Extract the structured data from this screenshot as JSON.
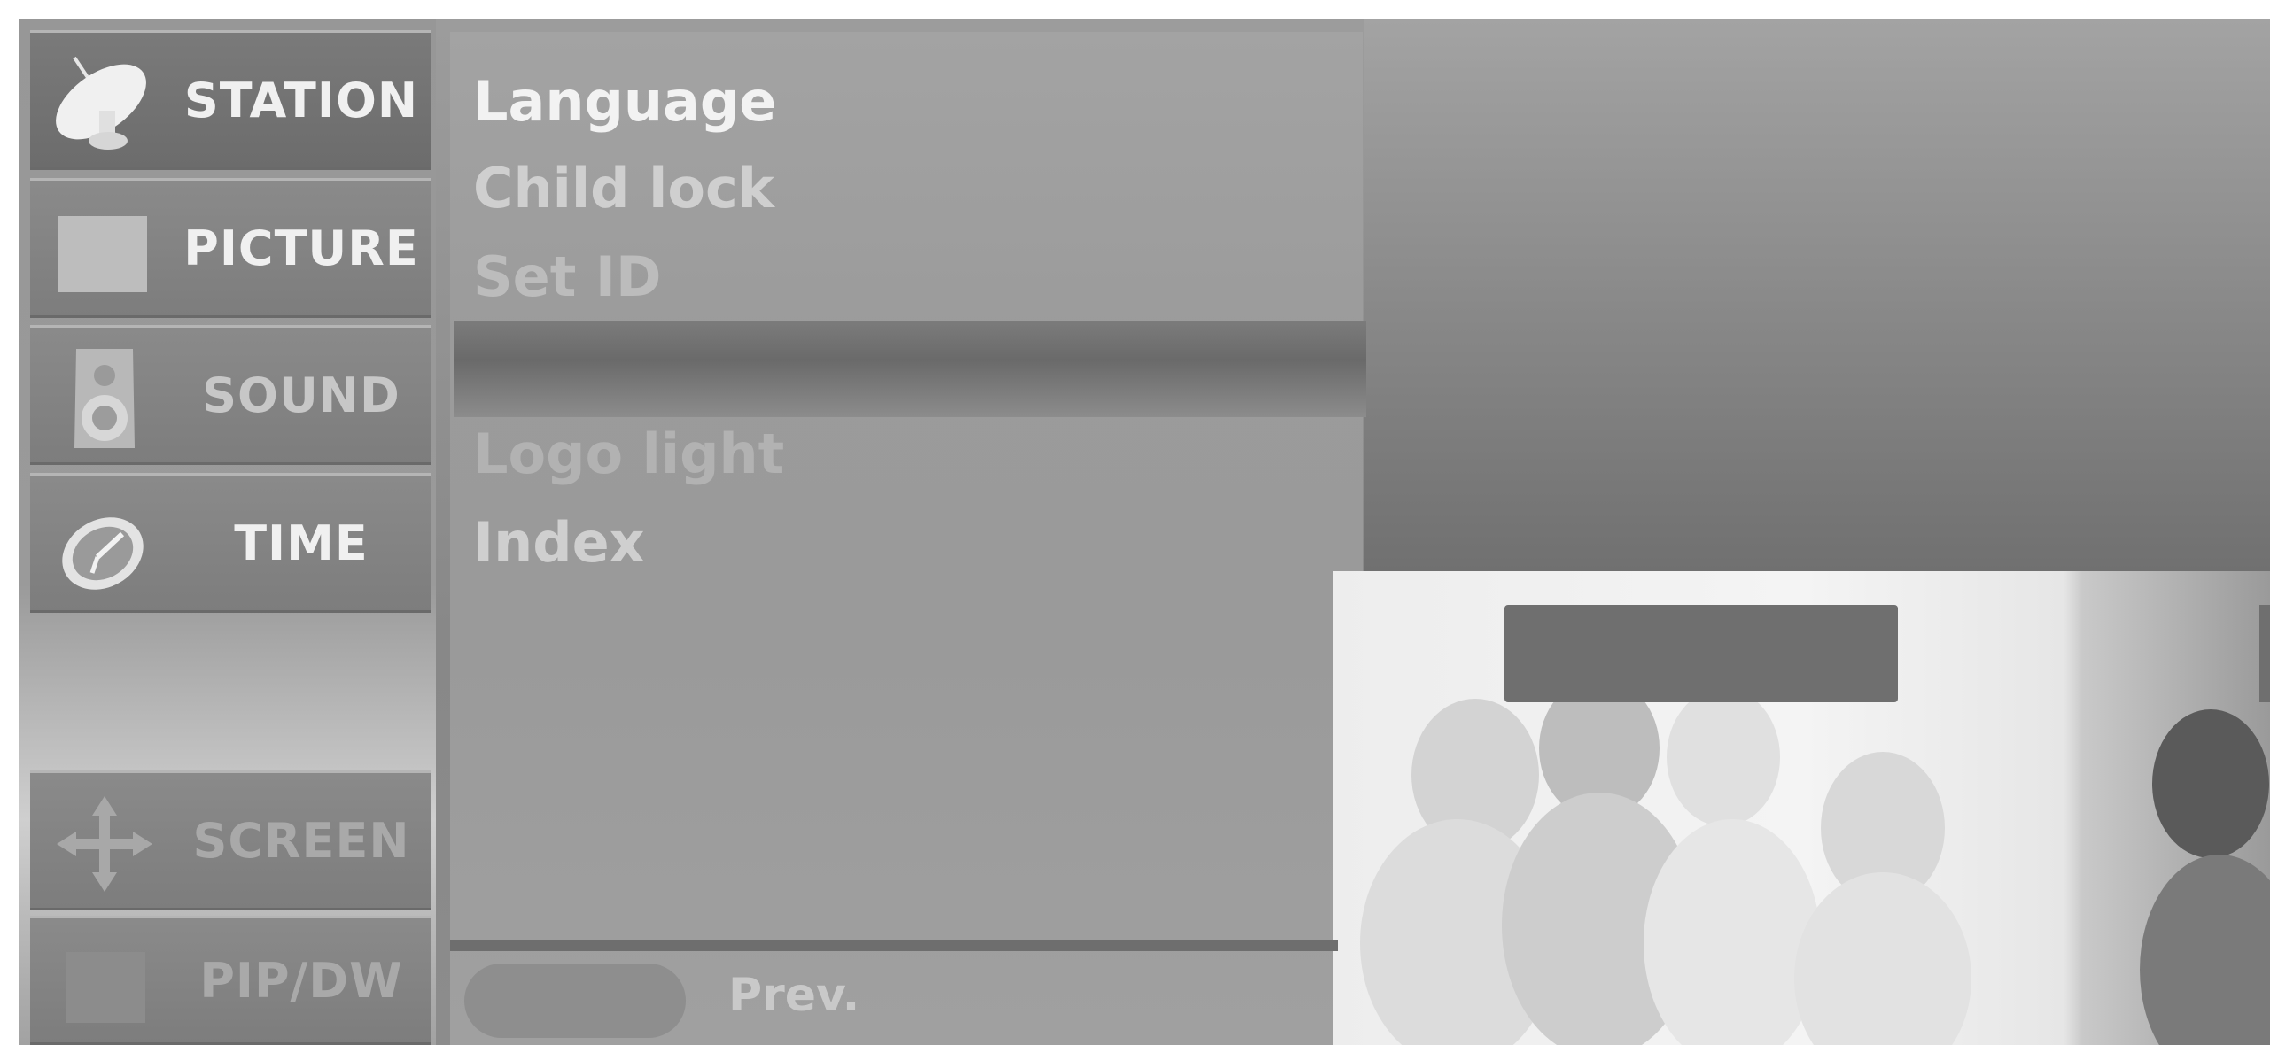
{
  "sidebar": {
    "items": [
      {
        "label": "STATION",
        "icon": "satellite-dish-icon",
        "state": "selected"
      },
      {
        "label": "PICTURE",
        "icon": "picture-square-icon",
        "state": "normal"
      },
      {
        "label": "SOUND",
        "icon": "speaker-icon",
        "state": "normal"
      },
      {
        "label": "TIME",
        "icon": "clock-icon",
        "state": "normal"
      },
      {
        "label": "SCREEN",
        "icon": "move-arrows-icon",
        "state": "dimmed"
      },
      {
        "label": "PIP/DW",
        "icon": "pip-window-icon",
        "state": "dimmed"
      }
    ]
  },
  "submenu": {
    "items": [
      {
        "label": "Language",
        "state": "highlighted"
      },
      {
        "label": "Child lock",
        "state": "normal"
      },
      {
        "label": "Set ID",
        "state": "normal"
      },
      {
        "label": "Logo light",
        "state": "faded"
      },
      {
        "label": "Index",
        "state": "normal"
      }
    ]
  },
  "footer": {
    "prev_label": "Prev."
  },
  "colors": {
    "highlight_text": "#f2f2f2",
    "normal_text": "#cfcfcf",
    "faded_text": "#b2b2b2",
    "panel": "#9c9c9c"
  }
}
